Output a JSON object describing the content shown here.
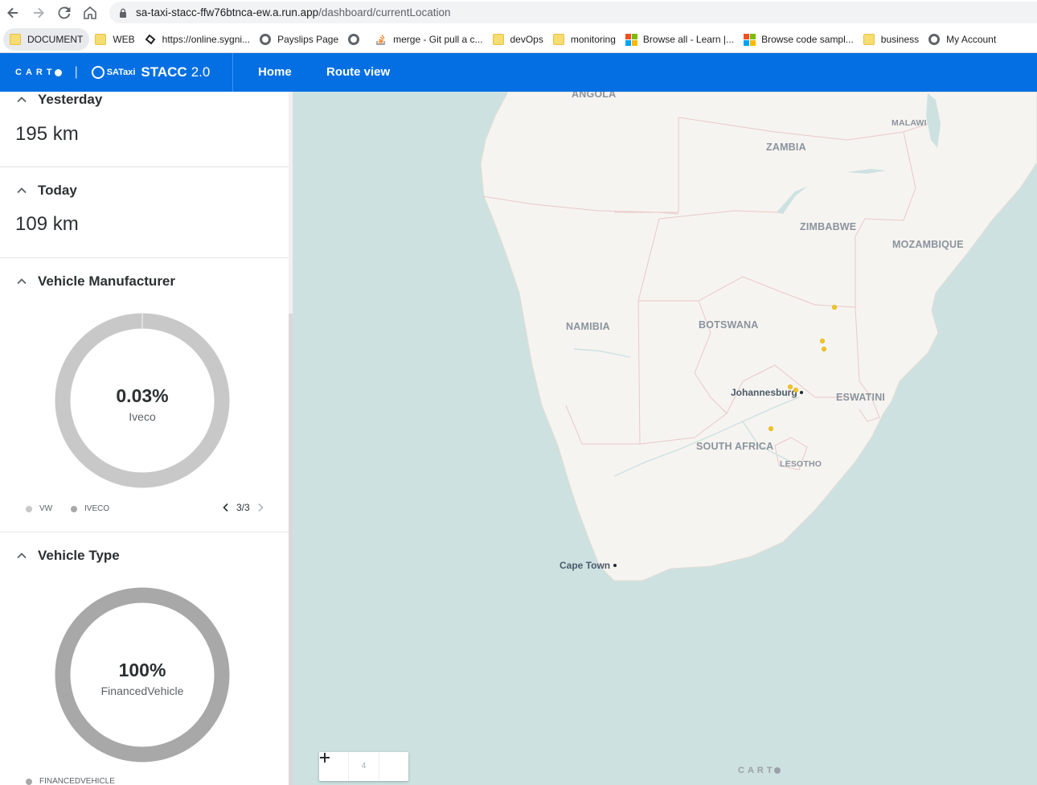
{
  "browser": {
    "url_host": "sa-taxi-stacc-ffw76btnca-ew.a.run.app",
    "url_path": "/dashboard/currentLocation",
    "bookmarks": [
      {
        "label": "DOCUMENT",
        "icon": "folder-icon"
      },
      {
        "label": "WEB",
        "icon": "folder-icon"
      },
      {
        "label": "https://online.sygni...",
        "icon": "site-icon"
      },
      {
        "label": "Payslips Page",
        "icon": "globe-icon"
      },
      {
        "label": "",
        "icon": "globe-icon"
      },
      {
        "label": "merge - Git pull a c...",
        "icon": "stackoverflow-icon"
      },
      {
        "label": "devOps",
        "icon": "folder-icon"
      },
      {
        "label": "monitoring",
        "icon": "folder-icon"
      },
      {
        "label": "Browse all - Learn |...",
        "icon": "microsoft-icon"
      },
      {
        "label": "Browse code sampl...",
        "icon": "microsoft-icon"
      },
      {
        "label": "business",
        "icon": "folder-icon"
      },
      {
        "label": "My Account",
        "icon": "globe-icon"
      }
    ]
  },
  "header": {
    "carto_logo": "CART",
    "separator": "|",
    "brand_small": "SATaxi",
    "brand_name": "STACC",
    "brand_version": "2.0",
    "nav": {
      "home": "Home",
      "route_view": "Route view"
    },
    "accent_color": "#036fe2"
  },
  "sidebar": {
    "yesterday": {
      "title": "Yesterday",
      "value": "195 km"
    },
    "today": {
      "title": "Today",
      "value": "109 km"
    },
    "manufacturer": {
      "title": "Vehicle Manufacturer",
      "center_value": "0.03%",
      "center_label": "Iveco",
      "legend": [
        {
          "label": "VW",
          "color": "#c8c8c8"
        },
        {
          "label": "IVECO",
          "color": "#a8a8a8"
        }
      ],
      "page": "3/3",
      "share_iveco": 0.0003
    },
    "vehicle_type": {
      "title": "Vehicle Type",
      "center_value": "100%",
      "center_label": "FinancedVehicle",
      "legend": [
        {
          "label": "FINANCEDVEHICLE",
          "color": "#a8a8a8"
        }
      ]
    }
  },
  "map": {
    "countries": {
      "angola": "ANGOLA",
      "zambia": "ZAMBIA",
      "malawi": "MALAWI",
      "zimbabwe": "ZIMBABWE",
      "mozambique": "MOZAMBIQUE",
      "namibia": "NAMIBIA",
      "botswana": "BOTSWANA",
      "eswatini": "ESWATINI",
      "south_africa": "SOUTH AFRICA",
      "lesotho": "LESOTHO"
    },
    "cities": {
      "johannesburg": "Johannesburg",
      "cape_town": "Cape Town"
    },
    "zoom_level": "4",
    "attribution": "CART",
    "marker_color": "#f3c72a",
    "land_color": "#f6f4f0",
    "water_color": "#cde1e1"
  }
}
